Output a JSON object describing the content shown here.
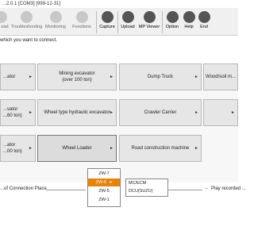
{
  "window": {
    "title": "...2.0.1 [COM3] [999-12-31]"
  },
  "toolbar": {
    "items": [
      {
        "label": "oad",
        "icon": "load-icon",
        "active": false
      },
      {
        "label": "Troubleshooting",
        "icon": "troubleshooting-icon",
        "active": false
      },
      {
        "label": "Monitoring",
        "icon": "monitoring-icon",
        "active": false
      },
      {
        "label": "Functions",
        "icon": "functions-icon",
        "active": false
      },
      {
        "label": "Capture",
        "icon": "camera-icon",
        "active": true
      },
      {
        "label": "Upload",
        "icon": "upload-icon",
        "active": true
      },
      {
        "label": "MP Viewer",
        "icon": "mp-viewer-icon",
        "active": true
      },
      {
        "label": "Option",
        "icon": "option-icon",
        "active": true
      },
      {
        "label": "Help",
        "icon": "help-icon",
        "active": true
      },
      {
        "label": "End",
        "icon": "end-icon",
        "active": true
      }
    ]
  },
  "prompt": "which you want to connect.",
  "grid": {
    "cells": [
      {
        "label": "...ator",
        "has_arrow": true
      },
      {
        "label": "Mining excavator\n(over 100 ton)",
        "has_arrow": true
      },
      {
        "label": "Dump Truck",
        "has_arrow": true
      },
      {
        "label": "Wood/soil m...",
        "has_arrow": false
      },
      {
        "label": "...vator\n...60 ton)",
        "has_arrow": true
      },
      {
        "label": "Wheel type hydraulic excavator",
        "has_arrow": true
      },
      {
        "label": "Crawler Carrier",
        "has_arrow": true
      },
      {
        "label": "",
        "has_arrow": true
      },
      {
        "label": "...ator\n...00 ton)",
        "has_arrow": true
      },
      {
        "label": "Wheel Loader",
        "has_arrow": true
      },
      {
        "label": "Road construction machine",
        "has_arrow": true
      }
    ]
  },
  "bottom": {
    "left_text": "...of Connection Place",
    "right_text": "Play recorded ..."
  },
  "menu": {
    "items": [
      "ZW-7",
      "ZW-6",
      "ZW-5",
      "ZW-1"
    ],
    "highlighted": "ZW-6",
    "submenu_arrow": "▸"
  },
  "submenu": {
    "items": [
      "MC/ECM",
      "DCU(SUZU)"
    ]
  },
  "colors": {
    "accent": "#e8830a"
  }
}
